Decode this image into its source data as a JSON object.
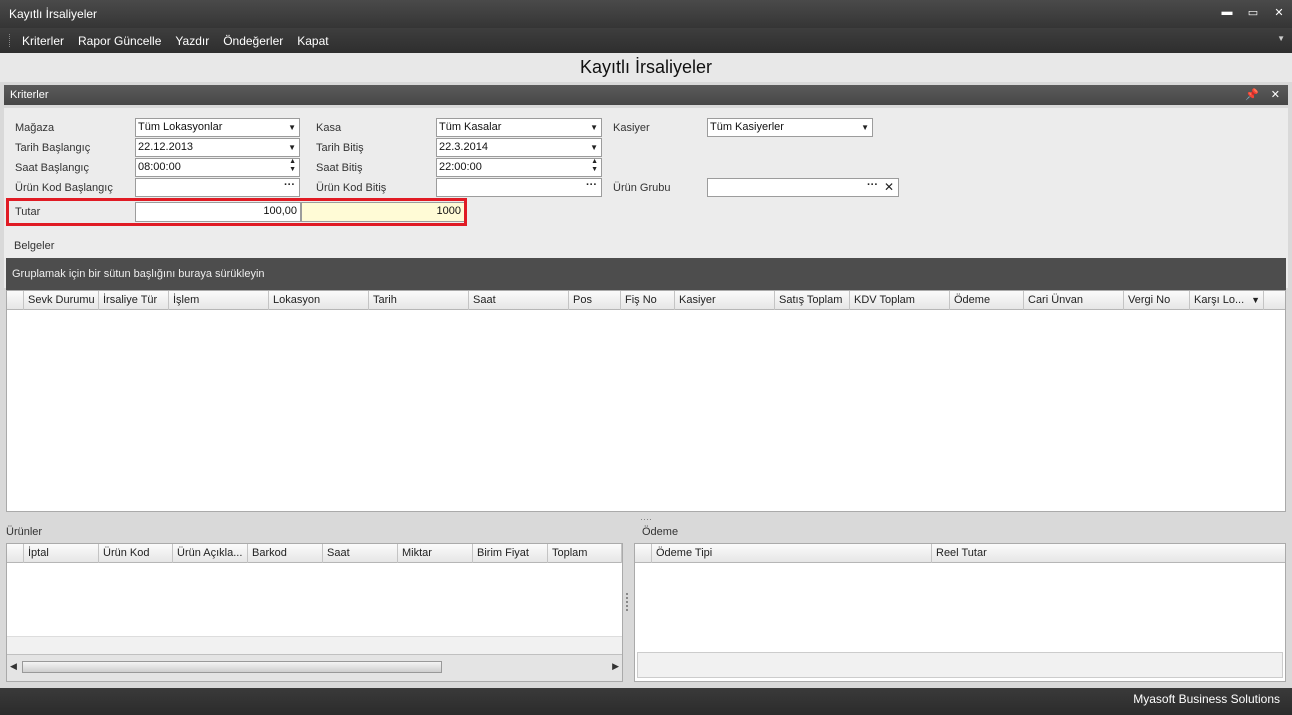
{
  "window": {
    "title": "Kayıtlı İrsaliyeler",
    "buttons": [
      "▬",
      "▭",
      "✕"
    ]
  },
  "menu": {
    "items": [
      "Kriterler",
      "Rapor Güncelle",
      "Yazdır",
      "Öndeğerler",
      "Kapat"
    ]
  },
  "page_title": "Kayıtlı İrsaliyeler",
  "kriterler": {
    "title": "Kriterler",
    "fields": {
      "magaza": {
        "label": "Mağaza",
        "value": "Tüm Lokasyonlar"
      },
      "kasa": {
        "label": "Kasa",
        "value": "Tüm Kasalar"
      },
      "kasiyer": {
        "label": "Kasiyer",
        "value": "Tüm Kasiyerler"
      },
      "tarih_baslangic": {
        "label": "Tarih Başlangıç",
        "value": "22.12.2013"
      },
      "tarih_bitis": {
        "label": "Tarih Bitiş",
        "value": "22.3.2014"
      },
      "saat_baslangic": {
        "label": "Saat Başlangıç",
        "value": "08:00:00"
      },
      "saat_bitis": {
        "label": "Saat Bitiş",
        "value": "22:00:00"
      },
      "urun_kod_baslangic": {
        "label": "Ürün Kod Başlangıç",
        "value": ""
      },
      "urun_kod_bitis": {
        "label": "Ürün Kod Bitiş",
        "value": ""
      },
      "urun_grubu": {
        "label": "Ürün Grubu",
        "value": ""
      },
      "tutar": {
        "label": "Tutar",
        "min": "100,00",
        "max": "1000"
      }
    }
  },
  "belgeler": {
    "title": "Belgeler",
    "group_hint": "Gruplamak için bir sütun başlığını buraya sürükleyin",
    "columns": [
      "Sevk Durumu",
      "İrsaliye Tür",
      "İşlem",
      "Lokasyon",
      "Tarih",
      "Saat",
      "Pos",
      "Fiş No",
      "Kasiyer",
      "Satış Toplam",
      "KDV Toplam",
      "Ödeme",
      "Cari Ünvan",
      "Vergi No",
      "Karşı Lo..."
    ]
  },
  "urunler": {
    "title": "Ürünler",
    "columns": [
      "İptal",
      "Ürün Kod",
      "Ürün Açıkla...",
      "Barkod",
      "Saat",
      "Miktar",
      "Birim Fiyat",
      "Toplam"
    ]
  },
  "odeme": {
    "title": "Ödeme",
    "columns": [
      "Ödeme Tipi",
      "Reel Tutar"
    ]
  },
  "status": {
    "text": "Myasoft Business Solutions"
  }
}
